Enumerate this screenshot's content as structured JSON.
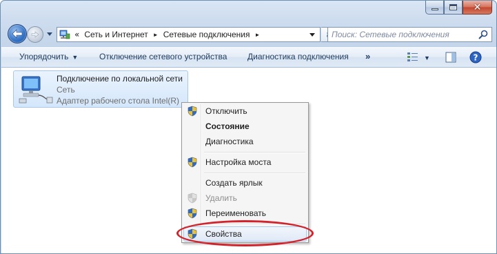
{
  "window": {
    "caption": {
      "minimize_icon": "minimize-icon",
      "maximize_icon": "maximize-icon",
      "close_icon": "close-icon",
      "close_glyph": "✕"
    }
  },
  "nav": {
    "back_icon": "back-arrow-icon",
    "forward_icon": "forward-arrow-icon",
    "recent_icon": "recent-pages-dropdown-icon",
    "address": {
      "overflow": "«",
      "crumbs": [
        "Сеть и Интернет",
        "Сетевые подключения"
      ],
      "separator": "►"
    },
    "search_placeholder": "Поиск: Сетевые подключения"
  },
  "toolbar": {
    "organize": "Упорядочить",
    "disable_device": "Отключение сетевого устройства",
    "diagnose": "Диагностика подключения",
    "more": "»",
    "view_icon": "change-view-icon",
    "preview_icon": "preview-pane-icon",
    "help_icon": "help-icon",
    "caret": "▼"
  },
  "adapter": {
    "name": "Подключение по локальной сети",
    "network": "Сеть",
    "description": "Адаптер рабочего стола Intel(R) ..."
  },
  "context_menu": {
    "items": [
      {
        "label": "Отключить",
        "icon": "uac-shield-icon",
        "style": "normal"
      },
      {
        "label": "Состояние",
        "icon": "",
        "style": "bold"
      },
      {
        "label": "Диагностика",
        "icon": "",
        "style": "normal"
      },
      {
        "label": "Настройка моста",
        "icon": "uac-shield-icon",
        "style": "normal"
      },
      {
        "label": "Создать ярлык",
        "icon": "",
        "style": "normal"
      },
      {
        "label": "Удалить",
        "icon": "uac-shield-icon",
        "style": "disabled"
      },
      {
        "label": "Переименовать",
        "icon": "uac-shield-icon",
        "style": "normal"
      },
      {
        "label": "Свойства",
        "icon": "uac-shield-icon",
        "style": "hover"
      }
    ]
  },
  "annotation": {
    "color": "#d2222b",
    "target": "Свойства"
  }
}
